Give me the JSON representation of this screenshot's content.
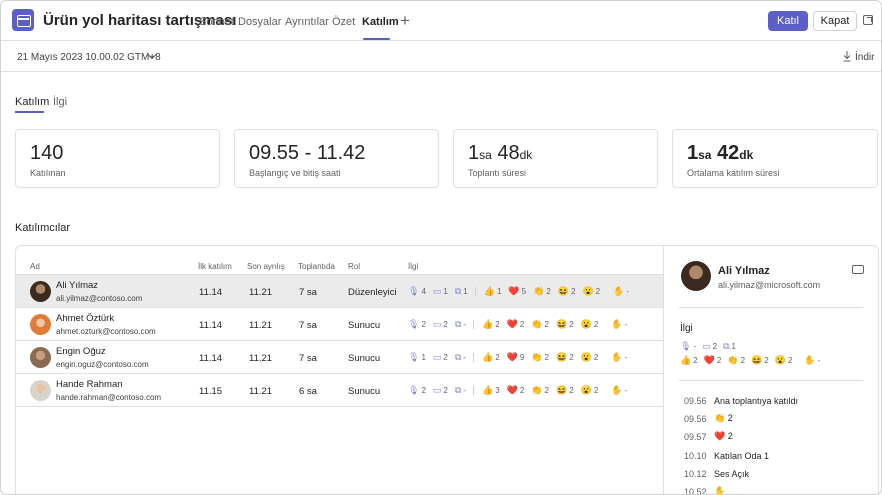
{
  "header": {
    "title": "Ürün yol haritası tartışması",
    "tabs": [
      {
        "label": "Sohbet",
        "active": false
      },
      {
        "label": "Dosyalar",
        "active": false
      },
      {
        "label": "Ayrıntılar",
        "active": false
      },
      {
        "label": "Özet",
        "active": false
      },
      {
        "label": "Katılım",
        "active": true
      }
    ],
    "join_label": "Katıl",
    "close_label": "Kapat",
    "accent_color": "#5b5fc7"
  },
  "datebar": {
    "date": "21 Mayıs 2023 10.00.02 GTM+8",
    "download_label": "İndir"
  },
  "subtabs": [
    {
      "label": "Katılım",
      "active": true
    },
    {
      "label": "İlgi",
      "active": false
    }
  ],
  "stats": {
    "attendees": {
      "value": "140",
      "label": "Katılınan"
    },
    "time": {
      "value": "09.55 - 11.42",
      "label": "Başlangıç ve bitiş saati"
    },
    "duration": {
      "hours": "1",
      "hours_unit": "sa",
      "minutes": "48",
      "minutes_unit": "dk",
      "label": "Toplantı süresi"
    },
    "avg": {
      "hours": "1",
      "hours_unit": "sa",
      "minutes": "42",
      "minutes_unit": "dk",
      "label": "Ortalama katılım süresi"
    }
  },
  "section_title": "Katılımcılar",
  "table": {
    "columns": [
      "Ad",
      "İlk katılım",
      "Son ayrılış",
      "Toplantıda",
      "Rol",
      "İlgi"
    ],
    "rows": [
      {
        "name": "Ali Yılmaz",
        "email": "ali.yilmaz@contoso.com",
        "first": "11.14",
        "last": "11.21",
        "duration": "7 sa",
        "role": "Düzenleyici",
        "mic": "4",
        "cam": "1",
        "share": "1",
        "like": "1",
        "heart": "5",
        "clap": "2",
        "laugh": "2",
        "surprise": "2",
        "hand": "-",
        "selected": true
      },
      {
        "name": "Ahmet Öztürk",
        "email": "ahmet.ozturk@contoso.com",
        "first": "11.14",
        "last": "11.21",
        "duration": "7 sa",
        "role": "Sunucu",
        "mic": "2",
        "cam": "2",
        "share": "-",
        "like": "2",
        "heart": "2",
        "clap": "2",
        "laugh": "2",
        "surprise": "2",
        "hand": "-",
        "selected": false
      },
      {
        "name": "Engin Oğuz",
        "email": "engin.oguz@contoso.com",
        "first": "11.14",
        "last": "11.21",
        "duration": "7 sa",
        "role": "Sunucu",
        "mic": "1",
        "cam": "2",
        "share": "-",
        "like": "2",
        "heart": "9",
        "clap": "2",
        "laugh": "2",
        "surprise": "2",
        "hand": "-",
        "selected": false
      },
      {
        "name": "Hande Rahman",
        "email": "hande.rahman@contoso.com",
        "first": "11.15",
        "last": "11.21",
        "duration": "6 sa",
        "role": "Sunucu",
        "mic": "2",
        "cam": "2",
        "share": "-",
        "like": "3",
        "heart": "2",
        "clap": "2",
        "laugh": "2",
        "surprise": "2",
        "hand": "-",
        "selected": false
      }
    ]
  },
  "panel": {
    "name": "Ali Yılmaz",
    "email": "ali.yilmaz@microsoft.com",
    "section": "İlgi",
    "mic": "-",
    "cam": "2",
    "share": "1",
    "like": "2",
    "heart": "2",
    "clap": "2",
    "laugh": "2",
    "surprise": "2",
    "hand": "-",
    "timeline": [
      {
        "time": "09.56",
        "text": "Ana toplantıya katıldı",
        "kind": "text"
      },
      {
        "time": "09.56",
        "text": "2",
        "kind": "clap"
      },
      {
        "time": "09.57",
        "text": "2",
        "kind": "heart"
      },
      {
        "time": "10.10",
        "text": "Katılan Oda 1",
        "kind": "text"
      },
      {
        "time": "10.12",
        "text": "Ses Açık",
        "kind": "text"
      },
      {
        "time": "10.52",
        "text": "",
        "kind": "hand"
      }
    ]
  }
}
